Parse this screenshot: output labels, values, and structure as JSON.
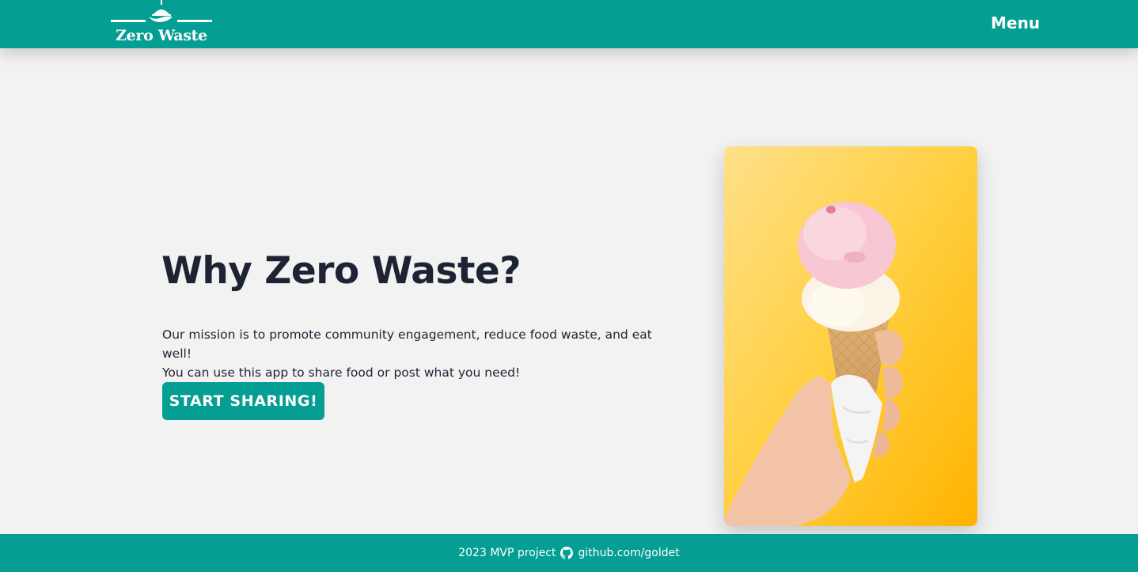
{
  "header": {
    "logo_text": "Zero Waste",
    "menu_label": "Menu"
  },
  "hero": {
    "title": "Why Zero Waste?",
    "line1": "Our mission is to promote community engagement, reduce food waste, and eat well!",
    "line2": "You can use this app to share food or post what you need!",
    "cta_label": "START SHARING!"
  },
  "image": {
    "subject": "hand holding ice cream cone on yellow background"
  },
  "footer": {
    "project_text": "2023 MVP project",
    "github_icon": "github-icon",
    "github_link": "github.com/goldet"
  },
  "colors": {
    "brand": "#049e93",
    "background": "#f2f2f2",
    "text_dark": "#1e2333"
  }
}
